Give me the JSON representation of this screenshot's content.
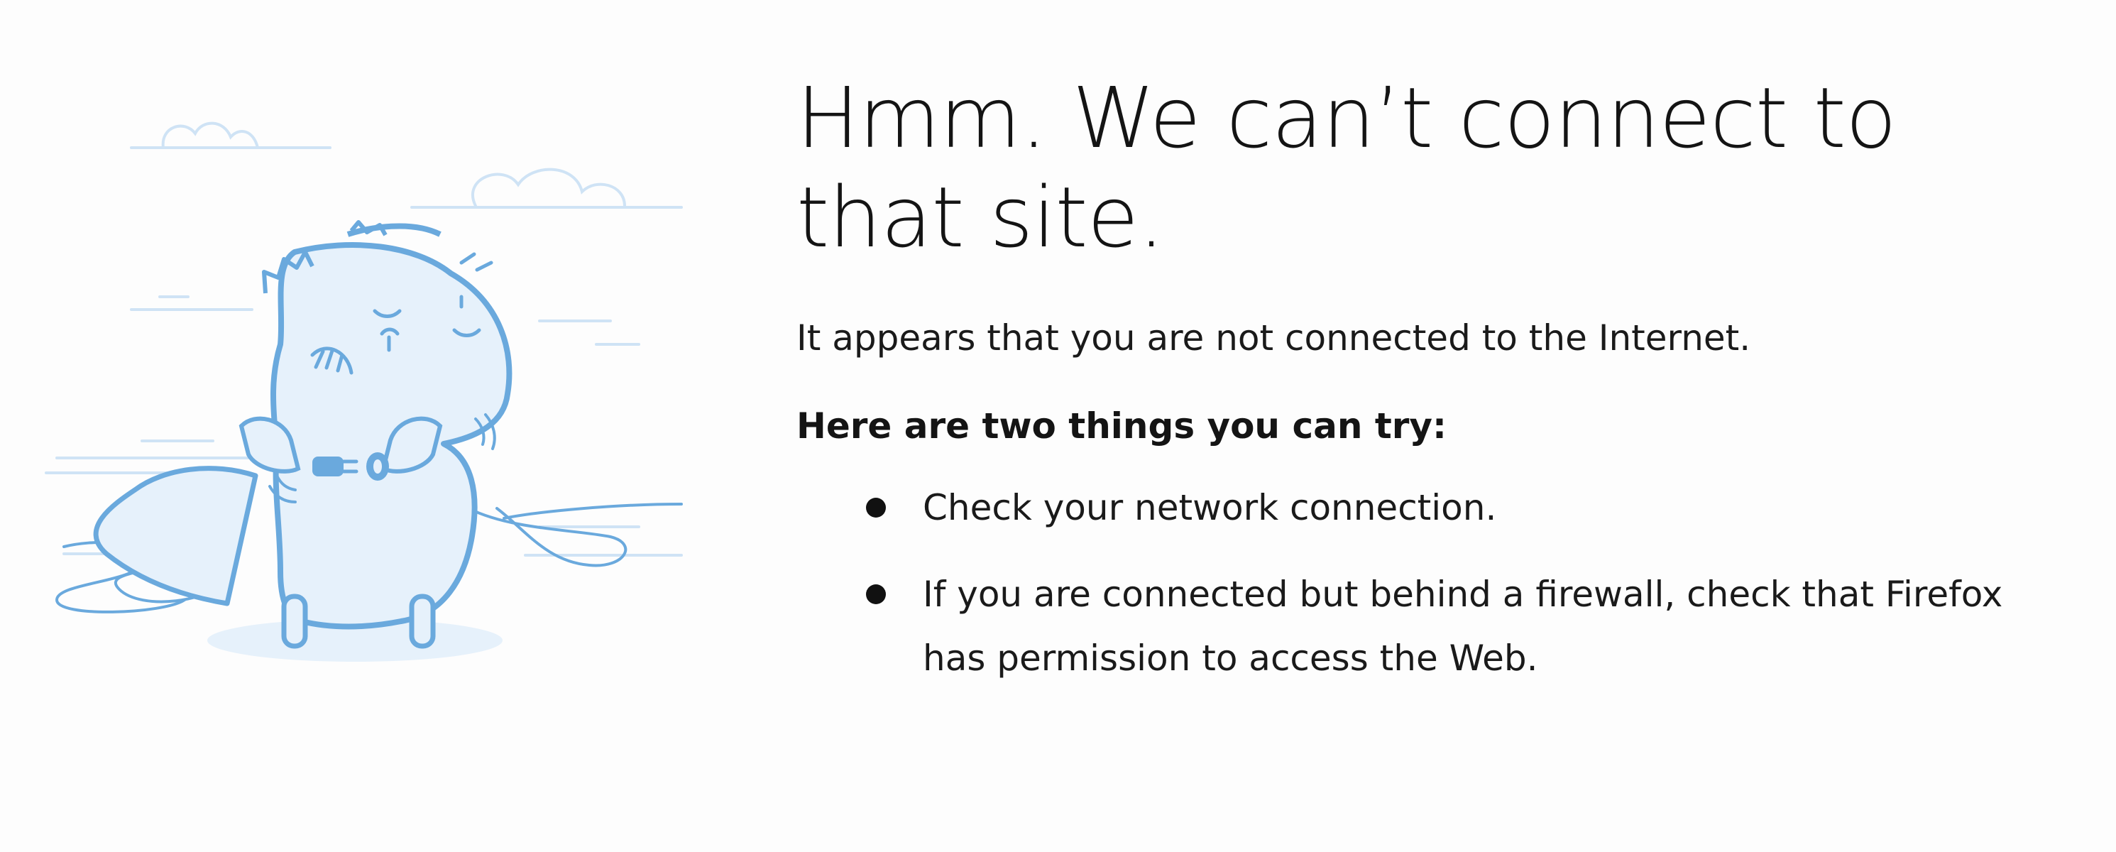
{
  "error_page": {
    "title": "Hmm. We can’t connect to that site.",
    "subtitle": "It appears that you are not connected to the Internet.",
    "heading": "Here are two things you can try:",
    "tips": [
      {
        "text": "Check your network connection."
      },
      {
        "text": "If you are connected but behind a firewall, check that Firefox has permission to access the Web."
      }
    ],
    "illustration_icon": "unplugged-dinosaur-illustration"
  },
  "colors": {
    "background": "#fdfdfd",
    "text": "#141414",
    "illustration_line": "#6aa9dd",
    "illustration_fill": "#e6f1fb"
  }
}
